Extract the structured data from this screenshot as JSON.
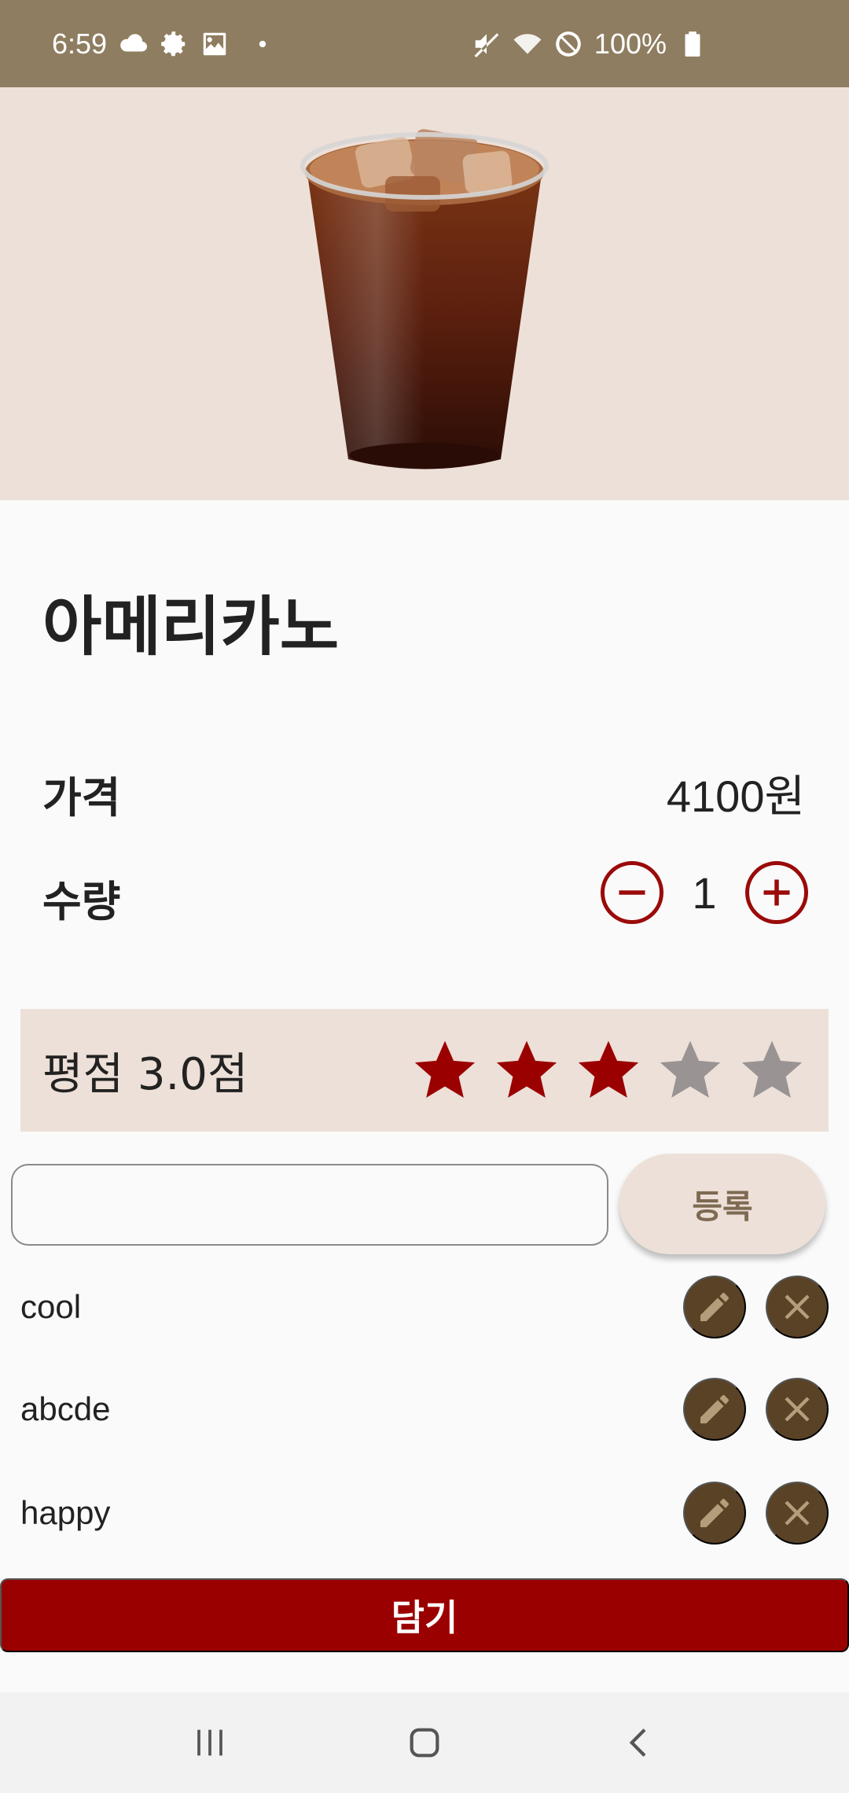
{
  "status_bar": {
    "time": "6:59",
    "battery": "100%",
    "icons_left": [
      "cloud-icon",
      "gear-icon",
      "image-icon",
      "dot-icon"
    ],
    "icons_right": [
      "mute-icon",
      "wifi-icon",
      "blocked-icon",
      "battery-icon"
    ]
  },
  "product": {
    "name": "아메리카노",
    "price_label": "가격",
    "price_value": "4100원",
    "quantity_label": "수량",
    "quantity_value": "1"
  },
  "rating": {
    "text": "평점 3.0점",
    "value": 3.0,
    "max": 5
  },
  "comment_form": {
    "input_value": "",
    "register_label": "등록"
  },
  "comments": [
    {
      "text": "cool"
    },
    {
      "text": "abcde"
    },
    {
      "text": "happy"
    }
  ],
  "cart": {
    "add_label": "담기"
  },
  "nav": {
    "icons": [
      "recent-apps-icon",
      "home-icon",
      "back-icon"
    ]
  },
  "colors": {
    "status_bar": "#8e7d60",
    "accent_red": "#9b0000",
    "star_filled": "#9b0000",
    "star_empty": "#999393",
    "cream": "#ede0d8",
    "action_brown": "#5a4226",
    "action_icon": "#b39e7c"
  }
}
